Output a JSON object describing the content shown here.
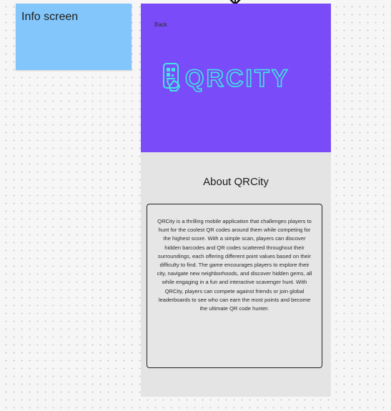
{
  "sticky_note": {
    "label": "Info screen",
    "color": "#82c6fb"
  },
  "connector": {
    "icon": "arrow-down-icon"
  },
  "screen": {
    "header_color": "#7a4cf9",
    "back_label": "Back",
    "logo": {
      "text": "QRCITY",
      "icon": "phone-qr-icon",
      "color": "#3ee6e4"
    },
    "about_title": "About QRCity",
    "about_body": "QRCity is a thrilling mobile application that challenges players to hunt for the coolest QR codes around them while competing for the highest score. With a simple scan, players can discover hidden barcodes and QR codes scattered throughout their surroundings, each offering different point values based on their difficulty to find. The game encourages players to explore their city, navigate new neighborhoods, and discover hidden gems, all while engaging in a fun and interactive scavenger hunt. With QRCity, players can compete against friends or join global leaderboards to see who can earn the most points and become the ultimate QR code hunter.",
    "body_color": "#e4e4e4"
  }
}
